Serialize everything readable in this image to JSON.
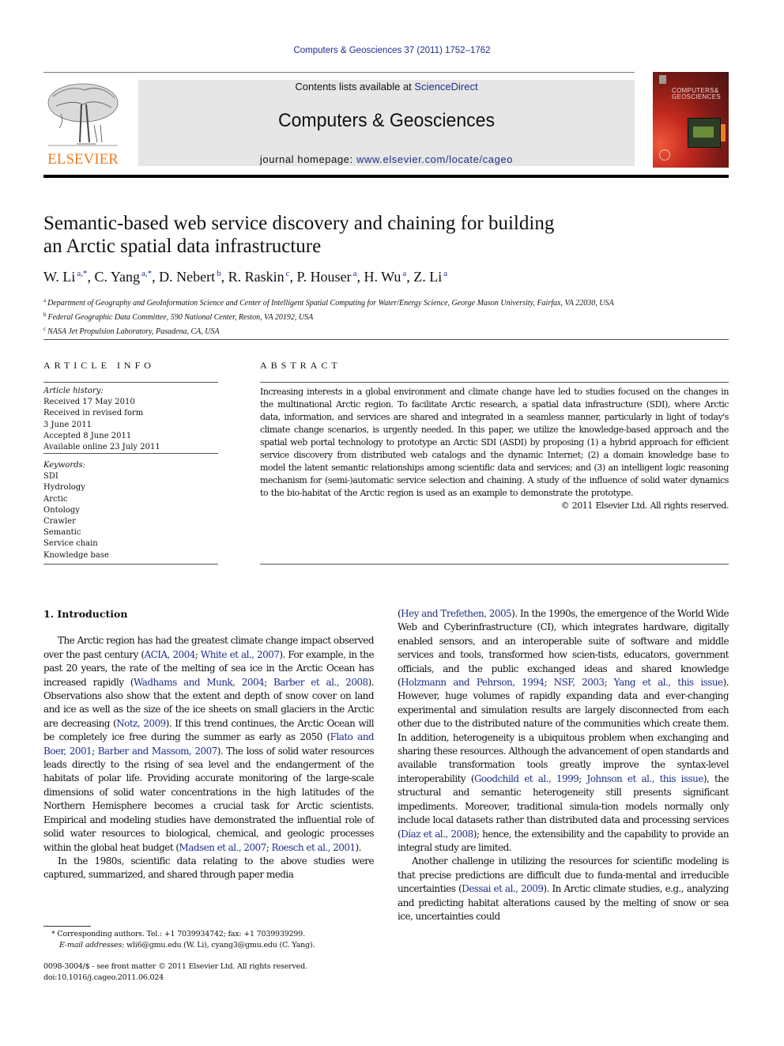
{
  "running_head": "Computers & Geosciences 37 (2011) 1752–1762",
  "header": {
    "publisher_logo_text": "ELSEVIER",
    "contents_prefix": "Contents lists available at ",
    "contents_link": "ScienceDirect",
    "journal_name": "Computers & Geosciences",
    "homepage_prefix": "journal homepage: ",
    "homepage_link": "www.elsevier.com/locate/cageo",
    "cover_title_line1": "COMPUTERS&",
    "cover_title_line2": "GEOSCIENCES"
  },
  "colors": {
    "link": "#1f2f8a",
    "elsevier_orange": "#f07d1f",
    "banner_bg": "#e6e6e6"
  },
  "article": {
    "title_line1": "Semantic-based web service discovery and chaining for building",
    "title_line2": "an Arctic spatial data infrastructure",
    "authors": [
      {
        "name": "W. Li",
        "sup": "a,*",
        "sep": ", "
      },
      {
        "name": "C. Yang",
        "sup": "a,*",
        "sep": ", "
      },
      {
        "name": "D. Nebert",
        "sup": "b",
        "sep": ", "
      },
      {
        "name": "R. Raskin",
        "sup": "c",
        "sep": ", "
      },
      {
        "name": "P. Houser",
        "sup": "a",
        "sep": ", "
      },
      {
        "name": "H. Wu",
        "sup": "a",
        "sep": ", "
      },
      {
        "name": "Z. Li",
        "sup": "a",
        "sep": ""
      }
    ],
    "affiliations": [
      {
        "mark": "a",
        "text": "Department of Geography and GeoInformation Science and Center of Intelligent Spatial Computing for Water/Energy Science, George Mason University, Fairfax, VA 22030, USA"
      },
      {
        "mark": "b",
        "text": "Federal Geographic Data Committee, 590 National Center, Reston, VA 20192, USA"
      },
      {
        "mark": "c",
        "text": "NASA Jet Propulsion Laboratory, Pasadena, CA, USA"
      }
    ]
  },
  "article_info": {
    "heading": "ARTICLE INFO",
    "history_label": "Article history:",
    "history": [
      "Received 17 May 2010",
      "Received in revised form",
      "3 June 2011",
      "Accepted 8 June 2011",
      "Available online 23 July 2011"
    ],
    "keywords_label": "Keywords:",
    "keywords": [
      "SDI",
      "Hydrology",
      "Arctic",
      "Ontology",
      "Crawler",
      "Semantic",
      "Service chain",
      "Knowledge base"
    ]
  },
  "abstract": {
    "heading": "ABSTRACT",
    "text": "Increasing interests in a global environment and climate change have led to studies focused on the changes in the multinational Arctic region. To facilitate Arctic research, a spatial data infrastructure (SDI), where Arctic data, information, and services are shared and integrated in a seamless manner, particularly in light of today's climate change scenarios, is urgently needed. In this paper, we utilize the knowledge-based approach and the spatial web portal technology to prototype an Arctic SDI (ASDI) by proposing (1) a hybrid approach for efficient service discovery from distributed web catalogs and the dynamic Internet; (2) a domain knowledge base to model the latent semantic relationships among scientific data and services; and (3) an intelligent logic reasoning mechanism for (semi-)automatic service selection and chaining. A study of the influence of solid water dynamics to the bio-habitat of the Arctic region is used as an example to demonstrate the prototype.",
    "copyright": "© 2011 Elsevier Ltd. All rights reserved."
  },
  "intro": {
    "heading": "1.  Introduction",
    "p1": [
      {
        "t": "The Arctic region has had the greatest climate change impact observed over the past century ("
      },
      {
        "l": "ACIA, 2004"
      },
      {
        "t": "; "
      },
      {
        "l": "White et al., 2007"
      },
      {
        "t": "). For example, in the past 20 years, the rate of the melting of sea ice in the Arctic Ocean has increased rapidly ("
      },
      {
        "l": "Wadhams and Munk, 2004"
      },
      {
        "t": "; "
      },
      {
        "l": "Barber et al., 2008"
      },
      {
        "t": "). Observations also show that the extent and depth of snow cover on land and ice as well as the size of the ice sheets on small glaciers in the Arctic are decreasing ("
      },
      {
        "l": "Notz, 2009"
      },
      {
        "t": "). If this trend continues, the Arctic Ocean will be completely ice free during the summer as early as 2050 ("
      },
      {
        "l": "Flato and Boer, 2001"
      },
      {
        "t": "; "
      },
      {
        "l": "Barber and Massom, 2007"
      },
      {
        "t": "). The loss of solid water resources leads directly to the rising of sea level and the endangerment of the habitats of polar life. Providing accurate monitoring of the large-scale dimensions of solid water concentrations in the high latitudes of the Northern Hemisphere becomes a crucial task for Arctic scientists. Empirical and modeling studies have demonstrated the influential role of solid water resources to biological, chemical, and geologic processes within the global heat budget ("
      },
      {
        "l": "Madsen et al., 2007"
      },
      {
        "t": "; "
      },
      {
        "l": "Roesch et al., 2001"
      },
      {
        "t": ")."
      }
    ],
    "p2_left": [
      {
        "t": "In the 1980s, scientific data relating to the above studies were captured, summarized, and shared through paper media"
      }
    ],
    "p2_right": [
      {
        "t": "("
      },
      {
        "l": "Hey and Trefethen, 2005"
      },
      {
        "t": "). In the 1990s, the emergence of the World Wide Web and Cyberinfrastructure (CI), which integrates hardware, digitally enabled sensors, and an interoperable suite of software and middle services and tools, transformed how scien-tists, educators, government officials, and the public exchanged ideas and shared knowledge ("
      },
      {
        "l": "Holzmann and Pehrson, 1994"
      },
      {
        "t": "; "
      },
      {
        "l": "NSF, 2003"
      },
      {
        "t": "; "
      },
      {
        "l": "Yang et al., this issue"
      },
      {
        "t": "). However, huge volumes of rapidly expanding data and ever-changing experimental and simulation results are largely disconnected from each other due to the distributed nature of the communities which create them. In addition, heterogeneity is a ubiquitous problem when exchanging and sharing these resources. Although the advancement of open standards and available transformation tools greatly improve the syntax-level interoperability ("
      },
      {
        "l": "Goodchild et al., 1999"
      },
      {
        "t": "; "
      },
      {
        "l": "Johnson et al., this issue"
      },
      {
        "t": "), the structural and semantic heterogeneity still presents significant impediments. Moreover, traditional simula-tion models normally only include local datasets rather than distributed data and processing services ("
      },
      {
        "l": "Díaz et al., 2008"
      },
      {
        "t": "); hence, the extensibility and the capability to provide an integral study are limited."
      }
    ],
    "p3": [
      {
        "t": "Another challenge in utilizing the resources for scientific modeling is that precise predictions are difficult due to funda-mental and irreducible uncertainties ("
      },
      {
        "l": "Dessai et al., 2009"
      },
      {
        "t": "). In Arctic climate studies, e.g., analyzing and predicting habitat alterations caused by the melting of snow or sea ice, uncertainties could"
      }
    ]
  },
  "footnote": {
    "corresponding": "* Corresponding authors. Tel.: +1 7039934742; fax: +1 7039939299.",
    "email_label": "E-mail addresses:",
    "email_text": " wli6@gmu.edu (W. Li), cyang3@gmu.edu (C. Yang)."
  },
  "front_matter": {
    "issn": "0098-3004/$ - see front matter © 2011 Elsevier Ltd. All rights reserved.",
    "doi": "doi:10.1016/j.cageo.2011.06.024"
  }
}
